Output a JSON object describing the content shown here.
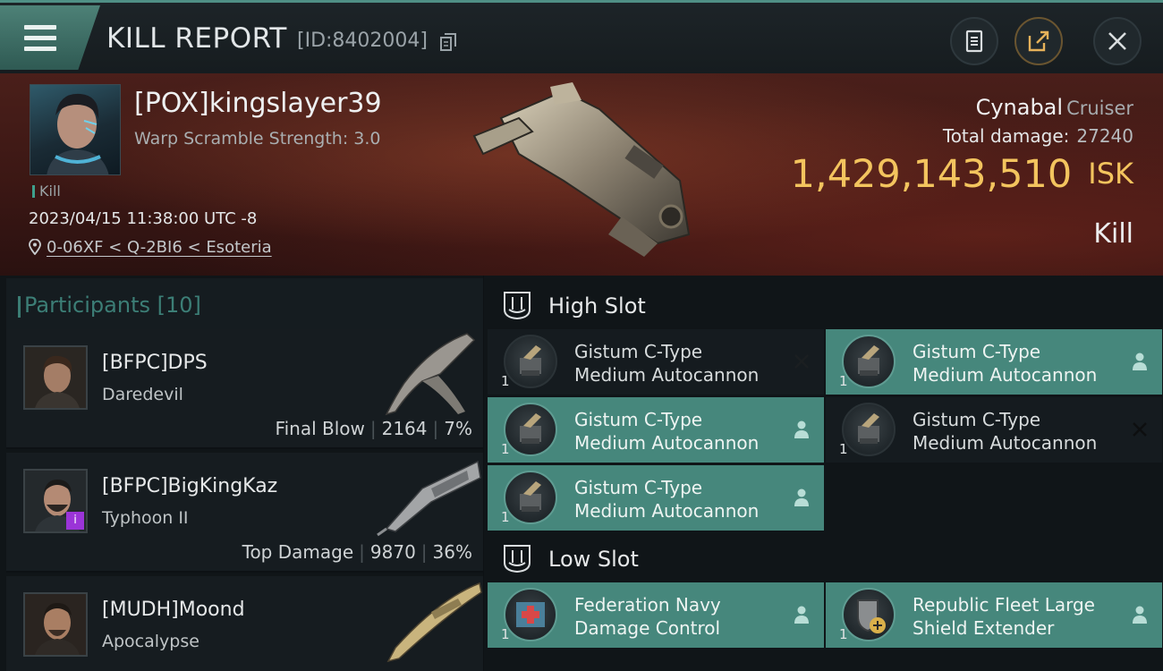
{
  "header": {
    "title": "KILL REPORT",
    "id": "[ID:8402004]"
  },
  "victim": {
    "pilot": "[POX]kingslayer39",
    "warp_scramble": "Warp Scramble Strength: 3.0",
    "tag": "Kill",
    "time": "2023/04/15 11:38:00 UTC -8",
    "location": "0-06XF < Q-2BI6 < Esoteria",
    "ship": "Cynabal",
    "ship_class": "Cruiser",
    "total_damage_label": "Total damage:",
    "total_damage": "27240",
    "isk_value": "1,429,143,510",
    "isk_unit": "ISK",
    "result": "Kill"
  },
  "participants": {
    "title": "Participants",
    "count": "[10]",
    "items": [
      {
        "name": "[BFPC]DPS",
        "ship": "Daredevil",
        "role": "Final Blow",
        "damage": "2164",
        "percent": "7%"
      },
      {
        "name": "[BFPC]BigKingKaz",
        "ship": "Typhoon II",
        "role": "Top Damage",
        "damage": "9870",
        "percent": "36%"
      },
      {
        "name": "[MUDH]Moond",
        "ship": "Apocalypse"
      }
    ]
  },
  "fitting": {
    "high_slot_title": "High Slot",
    "low_slot_title": "Low Slot",
    "high": [
      {
        "line1": "Gistum C-Type",
        "line2": "Medium Autocannon",
        "qty": "1",
        "status": "destroyed"
      },
      {
        "line1": "Gistum C-Type",
        "line2": "Medium Autocannon",
        "qty": "1",
        "status": "dropped"
      },
      {
        "line1": "Gistum C-Type",
        "line2": "Medium Autocannon",
        "qty": "1",
        "status": "dropped"
      },
      {
        "line1": "Gistum C-Type",
        "line2": "Medium Autocannon",
        "qty": "1",
        "status": "destroyed"
      },
      {
        "line1": "Gistum C-Type",
        "line2": "Medium Autocannon",
        "qty": "1",
        "status": "dropped"
      }
    ],
    "low": [
      {
        "line1": "Federation Navy",
        "line2": "Damage Control",
        "qty": "1",
        "status": "dropped"
      },
      {
        "line1": "Republic Fleet Large",
        "line2": "Shield Extender",
        "qty": "1",
        "status": "dropped"
      }
    ]
  },
  "colors": {
    "accent": "#46877c",
    "isk": "#f3c45e",
    "banner": "#3b1714"
  }
}
